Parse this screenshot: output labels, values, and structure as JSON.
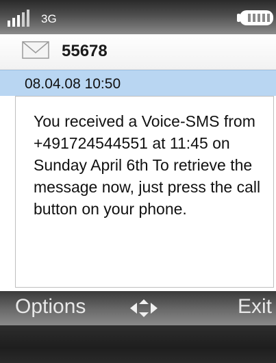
{
  "status_bar": {
    "network": "3G",
    "signal_icon": "signal-strength-icon",
    "battery_icon": "battery-icon",
    "text_color": "#ffffff"
  },
  "message": {
    "sender": "55678",
    "envelope_icon": "envelope-icon",
    "date": "08.04.08 10:50",
    "body": "You received a Voice-SMS from +491724544551 at 11:45 on Sunday April 6th To retrieve the message now, just press the call button on your phone.",
    "date_bar_color": "#b9d6f2"
  },
  "softkeys": {
    "left_label": "Options",
    "right_label": "Exit",
    "nav_icon": "navigation-diamond-icon"
  }
}
